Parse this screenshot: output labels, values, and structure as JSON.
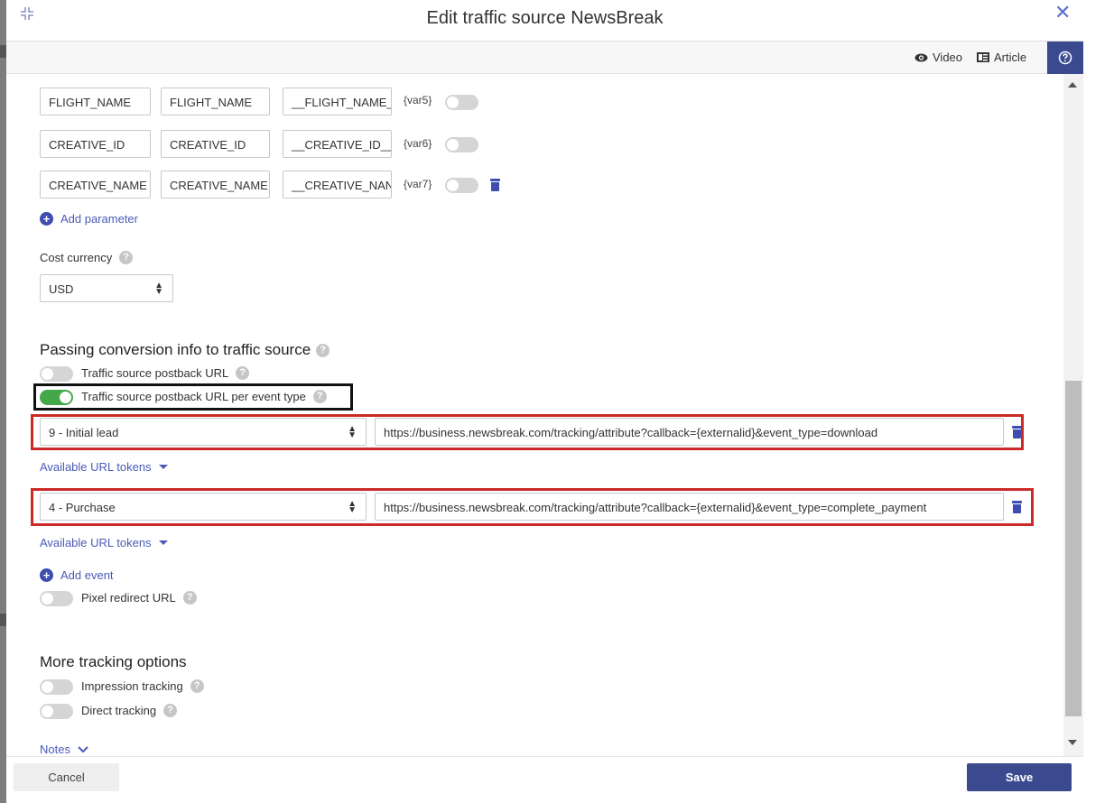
{
  "modal": {
    "title": "Edit traffic source NewsBreak",
    "toolbar": {
      "video_label": "Video",
      "article_label": "Article"
    }
  },
  "parameters": [
    {
      "name": "FLIGHT_NAME",
      "label": "FLIGHT_NAME",
      "token": "__FLIGHT_NAME_",
      "var": "{var5}",
      "enabled": false,
      "deletable": false
    },
    {
      "name": "CREATIVE_ID",
      "label": "CREATIVE_ID",
      "token": "__CREATIVE_ID__",
      "var": "{var6}",
      "enabled": false,
      "deletable": false
    },
    {
      "name": "CREATIVE_NAME",
      "label": "CREATIVE_NAME",
      "token": "__CREATIVE_NAN",
      "var": "{var7}",
      "enabled": false,
      "deletable": true
    }
  ],
  "add_parameter_label": "Add parameter",
  "cost_currency": {
    "label": "Cost currency",
    "value": "USD"
  },
  "conversion": {
    "title": "Passing conversion info to traffic source",
    "postback_url_label": "Traffic source postback URL",
    "postback_url_enabled": false,
    "postback_per_event_label": "Traffic source postback URL per event type",
    "postback_per_event_enabled": true,
    "events": [
      {
        "event": "9 - Initial lead",
        "url": "https://business.newsbreak.com/tracking/attribute?callback={externalid}&event_type=download"
      },
      {
        "event": "4 - Purchase",
        "url": "https://business.newsbreak.com/tracking/attribute?callback={externalid}&event_type=complete_payment"
      }
    ],
    "tokens_label": "Available URL tokens",
    "add_event_label": "Add event",
    "pixel_redirect_label": "Pixel redirect URL",
    "pixel_redirect_enabled": false
  },
  "more_tracking": {
    "title": "More tracking options",
    "impression_label": "Impression tracking",
    "impression_enabled": false,
    "direct_label": "Direct tracking",
    "direct_enabled": false,
    "notes_label": "Notes"
  },
  "footer": {
    "cancel_label": "Cancel",
    "save_label": "Save"
  },
  "colors": {
    "accent": "#3b4a8f",
    "link": "#4a5ab8",
    "toggle_on": "#44a84a",
    "highlight_red": "#cc2929"
  }
}
